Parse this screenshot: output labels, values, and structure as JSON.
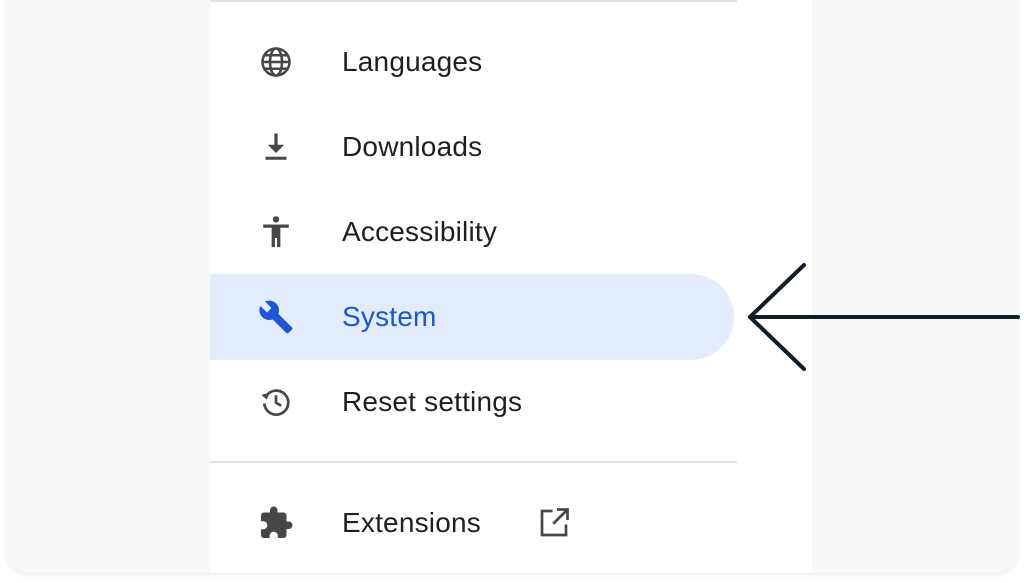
{
  "menu": {
    "items": [
      {
        "label": "Languages",
        "icon": "globe-icon"
      },
      {
        "label": "Downloads",
        "icon": "download-icon"
      },
      {
        "label": "Accessibility",
        "icon": "accessibility-icon"
      },
      {
        "label": "System",
        "icon": "wrench-icon",
        "selected": true
      },
      {
        "label": "Reset settings",
        "icon": "history-icon"
      },
      {
        "label": "Extensions",
        "icon": "puzzle-icon",
        "external_link_icon": "open-in-new-icon"
      }
    ]
  },
  "colors": {
    "selected_bg": "#e3ecfd",
    "selected_text": "#1a56d6",
    "text": "#1f1f1f",
    "icon": "#474747",
    "arrow": "#0e1c2b"
  },
  "annotation": {
    "arrow_icon": "left-arrow-icon",
    "points_to": "System"
  }
}
